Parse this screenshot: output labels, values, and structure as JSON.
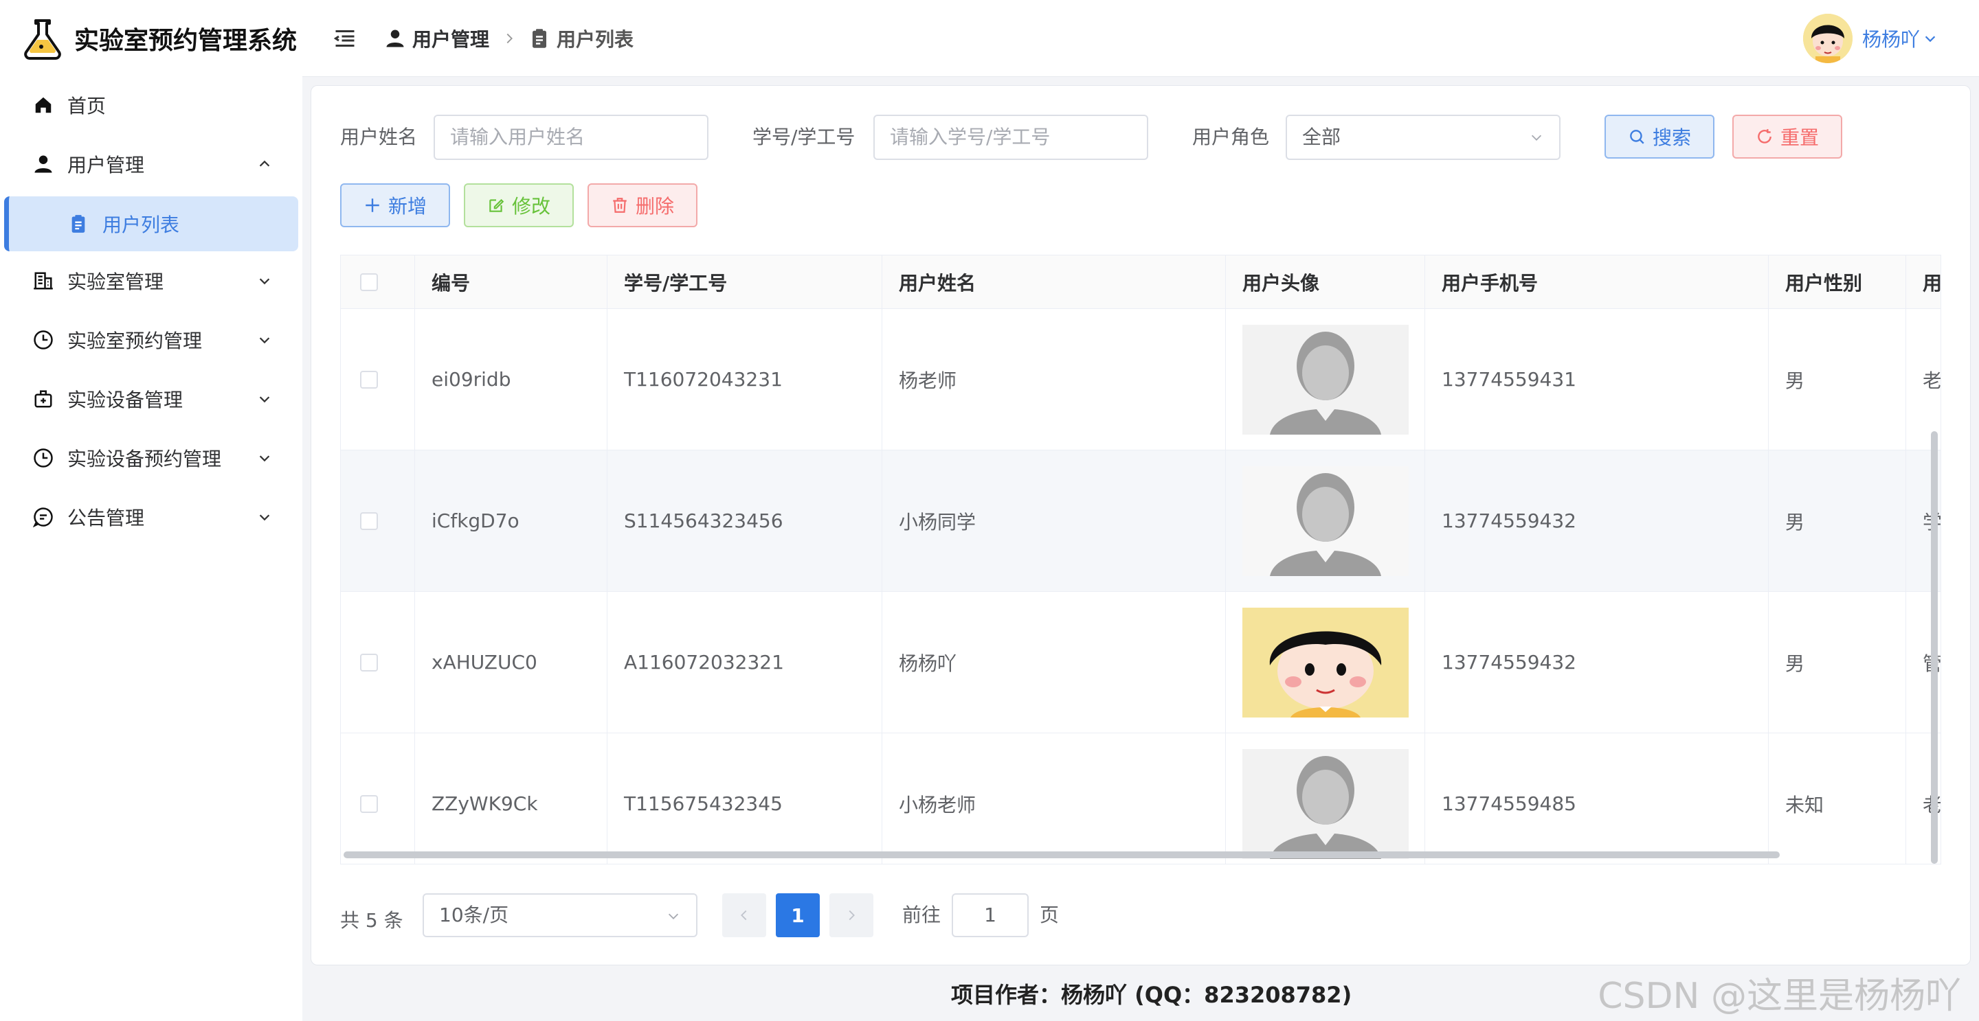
{
  "app": {
    "title": "实验室预约管理系统"
  },
  "sidebar": {
    "items": [
      {
        "label": "首页",
        "icon": "home-icon"
      },
      {
        "label": "用户管理",
        "icon": "user-icon",
        "expanded": true
      },
      {
        "label": "用户列表",
        "icon": "clipboard-icon",
        "active": true
      },
      {
        "label": "实验室管理",
        "icon": "building-icon"
      },
      {
        "label": "实验室预约管理",
        "icon": "clock-icon"
      },
      {
        "label": "实验设备管理",
        "icon": "box-icon"
      },
      {
        "label": "实验设备预约管理",
        "icon": "clock-icon"
      },
      {
        "label": "公告管理",
        "icon": "chat-icon"
      }
    ]
  },
  "header": {
    "breadcrumb": [
      "用户管理",
      "用户列表"
    ],
    "user_name": "杨杨吖"
  },
  "filters": {
    "name_label": "用户姓名",
    "name_placeholder": "请输入用户姓名",
    "id_label": "学号/学工号",
    "id_placeholder": "请输入学号/学工号",
    "role_label": "用户角色",
    "role_value": "全部",
    "search_label": "搜索",
    "reset_label": "重置"
  },
  "toolbar": {
    "add_label": "新增",
    "edit_label": "修改",
    "delete_label": "删除"
  },
  "table": {
    "columns": [
      "编号",
      "学号/学工号",
      "用户姓名",
      "用户头像",
      "用户手机号",
      "用户性别",
      "用"
    ],
    "rows": [
      {
        "id": "ei09ridb",
        "sid": "T116072043231",
        "name": "杨老师",
        "avatar": "default",
        "phone": "13774559431",
        "gender": "男",
        "role": "老"
      },
      {
        "id": "iCfkgD7o",
        "sid": "S114564323456",
        "name": "小杨同学",
        "avatar": "default",
        "phone": "13774559432",
        "gender": "男",
        "role": "学"
      },
      {
        "id": "xAHUZUC0",
        "sid": "A116072032321",
        "name": "杨杨吖",
        "avatar": "cartoon",
        "phone": "13774559432",
        "gender": "男",
        "role": "管"
      },
      {
        "id": "ZZyWK9Ck",
        "sid": "T115675432345",
        "name": "小杨老师",
        "avatar": "default",
        "phone": "13774559485",
        "gender": "未知",
        "role": "老"
      }
    ]
  },
  "pagination": {
    "total_text": "共 5 条",
    "page_size": "10条/页",
    "current": "1",
    "goto_label": "前往",
    "goto_value": "1",
    "page_suffix": "页"
  },
  "footer": {
    "text": "项目作者：杨杨吖 (QQ：823208782)"
  },
  "watermark": "CSDN @这里是杨杨吖",
  "colors": {
    "primary": "#3d7de0",
    "success": "#67c23a",
    "danger": "#f56c6c",
    "active_bg": "#d6e6fb"
  }
}
